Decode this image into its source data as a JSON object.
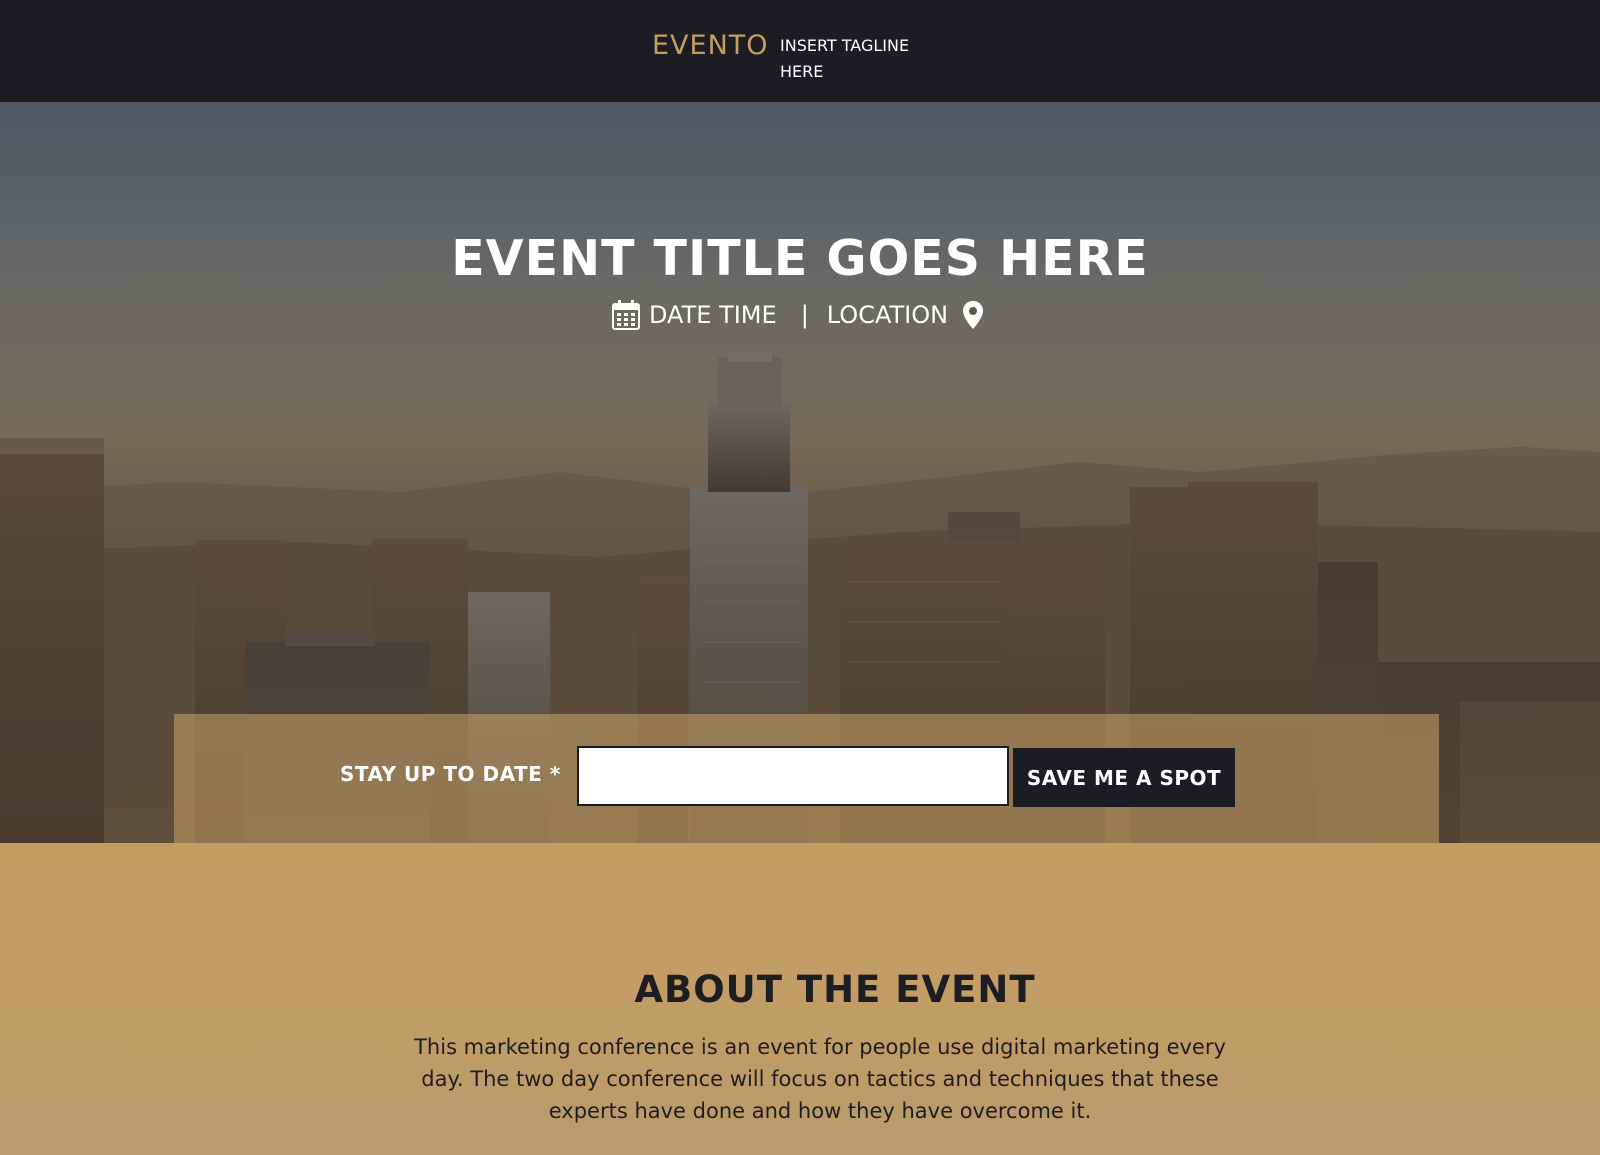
{
  "header": {
    "logo": "EVENTO",
    "tagline": "INSERT TAGLINE HERE"
  },
  "hero": {
    "title": "EVENT TITLE GOES HERE",
    "date_time": "DATE TIME",
    "separator": "|",
    "location": "LOCATION",
    "icons": [
      "calendar-icon",
      "map-pin-icon"
    ]
  },
  "signup": {
    "label": "STAY UP TO DATE *",
    "input_value": "",
    "button_label": "SAVE ME A SPOT"
  },
  "about": {
    "title": "ABOUT THE EVENT",
    "text": "This marketing conference is an event for people use digital marketing every day.  The two day conference will focus on tactics and techniques that these experts have done  and how they have overcome it."
  },
  "colors": {
    "header_bg": "#1b1d22",
    "accent_gold": "#c59d63",
    "about_bg": "#c29d64",
    "button_bg": "#1b1d22",
    "text_dark": "#1e1e22"
  }
}
